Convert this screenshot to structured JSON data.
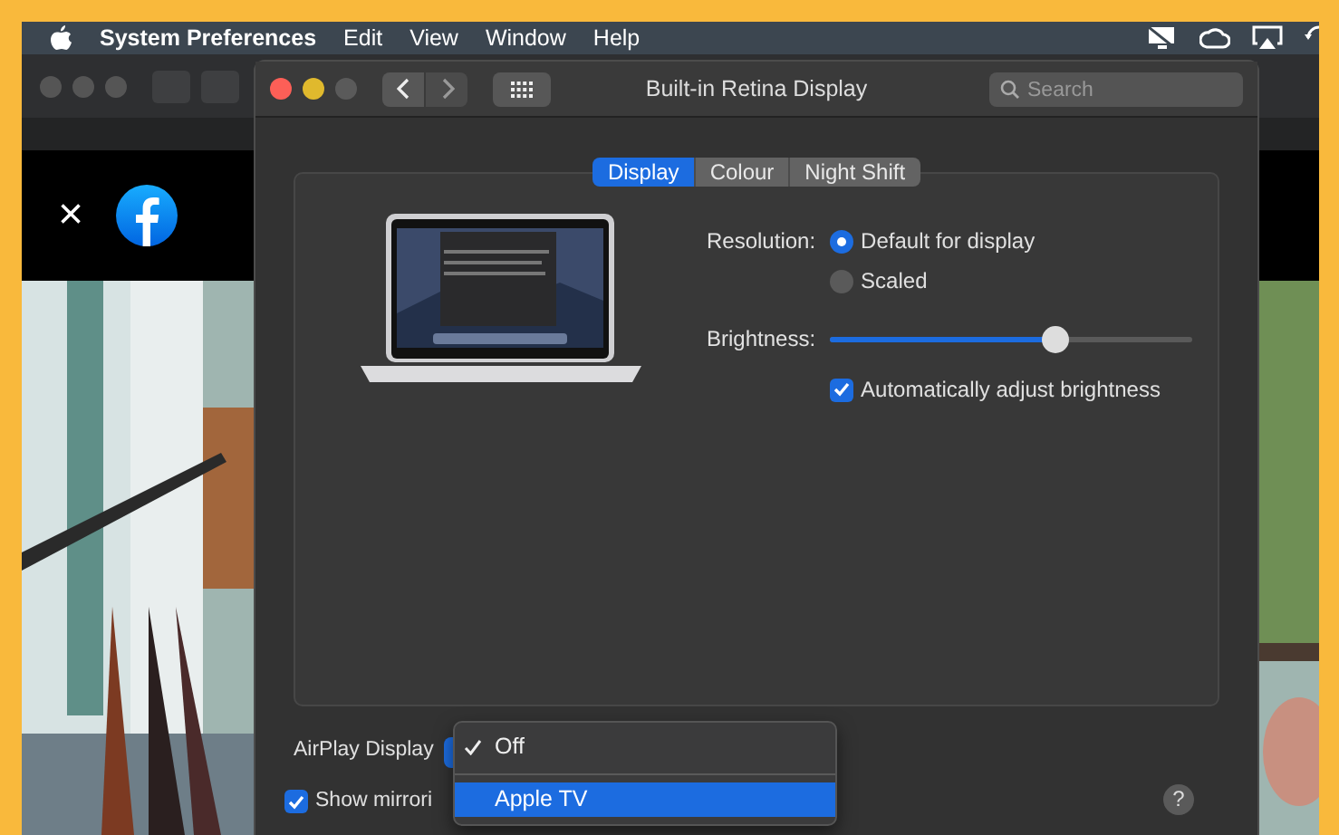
{
  "menu_bar": {
    "app_name": "System Preferences",
    "items": [
      "Edit",
      "View",
      "Window",
      "Help"
    ]
  },
  "browser": {
    "close": "×"
  },
  "window": {
    "title": "Built-in Retina Display",
    "search_placeholder": "Search"
  },
  "tabs": [
    {
      "label": "Display",
      "selected": true
    },
    {
      "label": "Colour",
      "selected": false
    },
    {
      "label": "Night Shift",
      "selected": false
    }
  ],
  "resolution": {
    "label": "Resolution:",
    "options": [
      {
        "label": "Default for display",
        "selected": true
      },
      {
        "label": "Scaled",
        "selected": false
      }
    ]
  },
  "brightness": {
    "label": "Brightness:",
    "level": 0.62,
    "auto": {
      "label": "Automatically adjust brightness",
      "checked": true
    }
  },
  "airplay": {
    "label": "AirPlay Display",
    "menu": [
      {
        "label": "Off",
        "checked": true,
        "selected": false
      },
      {
        "label": "Apple TV",
        "checked": false,
        "selected": true
      }
    ]
  },
  "mirroring": {
    "label": "Show mirrori",
    "checked": true
  },
  "help": "?"
}
